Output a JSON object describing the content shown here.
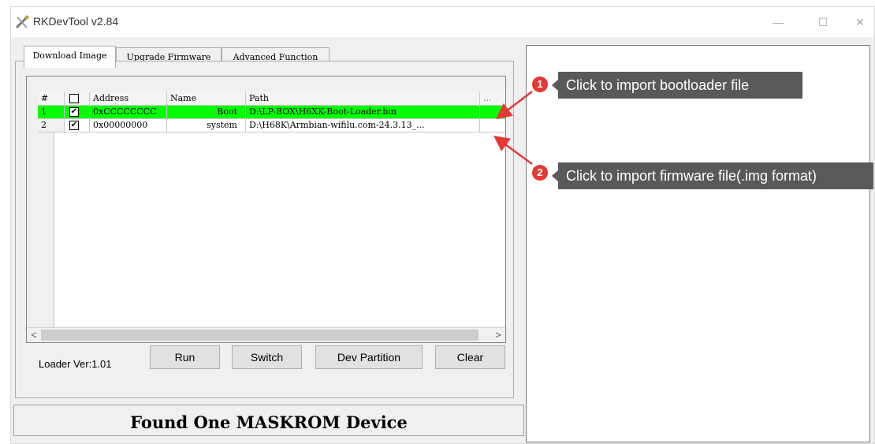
{
  "window": {
    "title": "RKDevTool v2.84",
    "controls": {
      "minimize": "—",
      "maximize": "☐",
      "close": "✕"
    }
  },
  "tabs": [
    {
      "label": "Download Image",
      "active": true
    },
    {
      "label": "Upgrade Firmware",
      "active": false
    },
    {
      "label": "Advanced Function",
      "active": false
    }
  ],
  "table": {
    "headers": [
      "#",
      "",
      "Address",
      "Name",
      "Path",
      "..."
    ],
    "rows": [
      {
        "num": "1",
        "checked": true,
        "address": "0xCCCCCCCC",
        "name": "Boot",
        "path": "D:\\LP-BOX\\H6XK-Boot-Loader.bin",
        "selected": true
      },
      {
        "num": "2",
        "checked": true,
        "address": "0x00000000",
        "name": "system",
        "path": "D:\\H68K\\Armbian-wifilu.com-24.3.13_...",
        "selected": false
      }
    ],
    "scroll_left": "<",
    "scroll_right": ">"
  },
  "loader_version": "Loader Ver:1.01",
  "buttons": {
    "run": "Run",
    "switch": "Switch",
    "dev_partition": "Dev Partition",
    "clear": "Clear"
  },
  "status": "Found One MASKROM Device",
  "annotations": [
    {
      "number": "1",
      "text": "Click to import bootloader file"
    },
    {
      "number": "2",
      "text": "Click to import firmware file(.img format)"
    }
  ],
  "colors": {
    "selected_row": "#00ff00",
    "callout_bg": "#595959",
    "badge": "#e53935",
    "arrow": "#e53935"
  }
}
